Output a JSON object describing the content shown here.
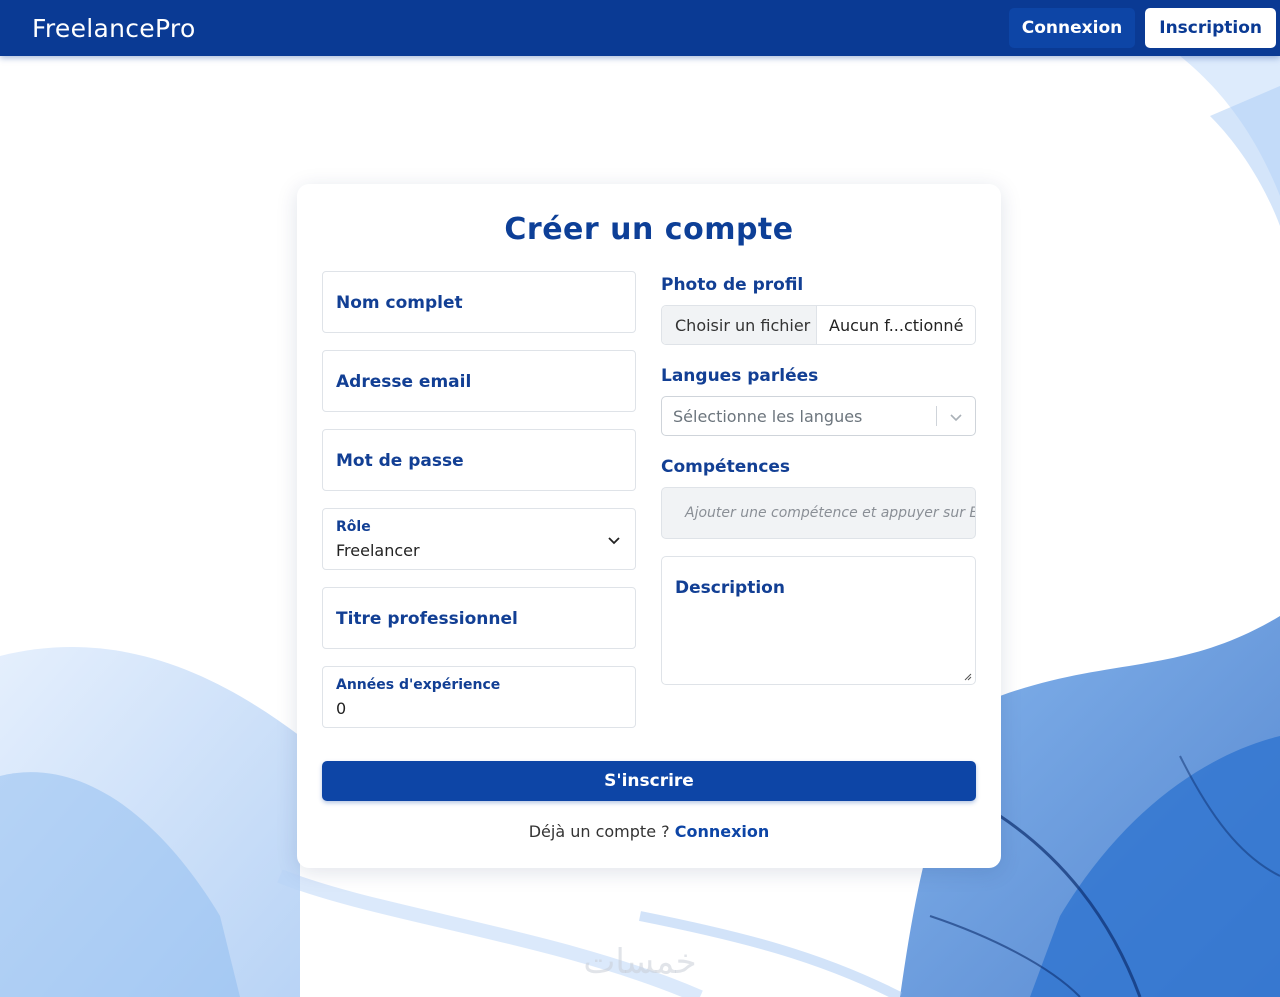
{
  "brand": {
    "name": "FreelancePro"
  },
  "nav": {
    "login_label": "Connexion",
    "signup_label": "Inscription"
  },
  "form": {
    "title": "Créer un compte",
    "full_name_placeholder": "Nom complet",
    "email_placeholder": "Adresse email",
    "password_placeholder": "Mot de passe",
    "role": {
      "label": "Rôle",
      "value": "Freelancer"
    },
    "job_title_placeholder": "Titre professionnel",
    "experience": {
      "label": "Années d'expérience",
      "value": "0"
    },
    "photo": {
      "label": "Photo de profil",
      "button": "Choisir un fichier",
      "file_status": "Aucun f...ctionné"
    },
    "languages": {
      "label": "Langues parlées",
      "placeholder": "Sélectionne les langues"
    },
    "skills": {
      "label": "Compétences",
      "placeholder": "Ajouter une compétence et appuyer sur Entrée"
    },
    "description_placeholder": "Description",
    "submit_label": "S'inscrire",
    "footer_text": "Déjà un compte ?",
    "footer_link": "Connexion"
  },
  "watermark": "خمسات",
  "colors": {
    "primary": "#0a3a94",
    "button": "#0d45a6",
    "label": "#123f94"
  },
  "icons": [
    "chevron-down-icon",
    "resize-grip-icon"
  ]
}
